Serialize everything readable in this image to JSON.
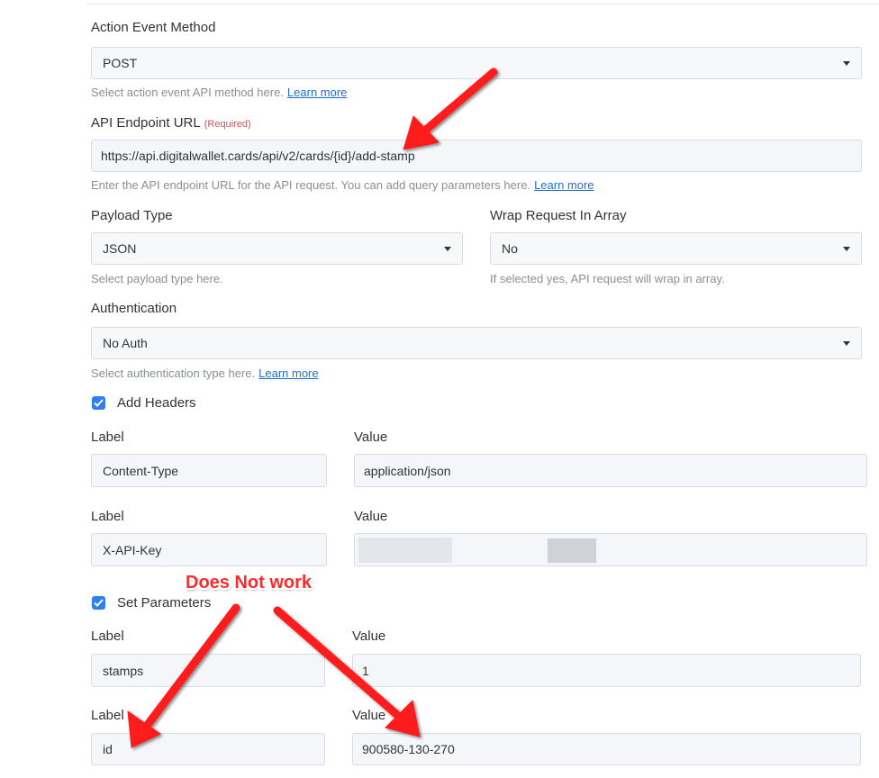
{
  "action_event_method": {
    "label": "Action Event Method",
    "value": "POST",
    "help": "Select action event API method here.",
    "help_link": "Learn more"
  },
  "api_endpoint": {
    "label": "API Endpoint URL",
    "required": "(Required)",
    "value": "https://api.digitalwallet.cards/api/v2/cards/{id}/add-stamp",
    "help": "Enter the API endpoint URL for the API request. You can add query parameters here.",
    "help_link": "Learn more"
  },
  "payload_type": {
    "label": "Payload Type",
    "value": "JSON",
    "help": "Select payload type here."
  },
  "wrap_request": {
    "label": "Wrap Request In Array",
    "value": "No",
    "help": "If selected yes, API request will wrap in array."
  },
  "authentication": {
    "label": "Authentication",
    "value": "No Auth",
    "help": "Select authentication type here.",
    "help_link": "Learn more"
  },
  "headers": {
    "checkbox_label": "Add Headers",
    "rows": [
      {
        "label_title": "Label",
        "value_title": "Value",
        "label": "Content-Type",
        "value": "application/json"
      },
      {
        "label_title": "Label",
        "value_title": "Value",
        "label": "X-API-Key",
        "value": ""
      }
    ]
  },
  "parameters": {
    "checkbox_label": "Set Parameters",
    "rows": [
      {
        "label_title": "Label",
        "value_title": "Value",
        "label": "stamps",
        "value": "1"
      },
      {
        "label_title": "Label",
        "value_title": "Value",
        "label": "id",
        "value": "900580-130-270"
      }
    ]
  },
  "annotation": {
    "text": "Does Not work",
    "color": "#ff2b2b"
  },
  "colors": {
    "checkbox": "#2f80ed",
    "link": "#1f6fd1",
    "field_bg": "#f4f6f9"
  }
}
